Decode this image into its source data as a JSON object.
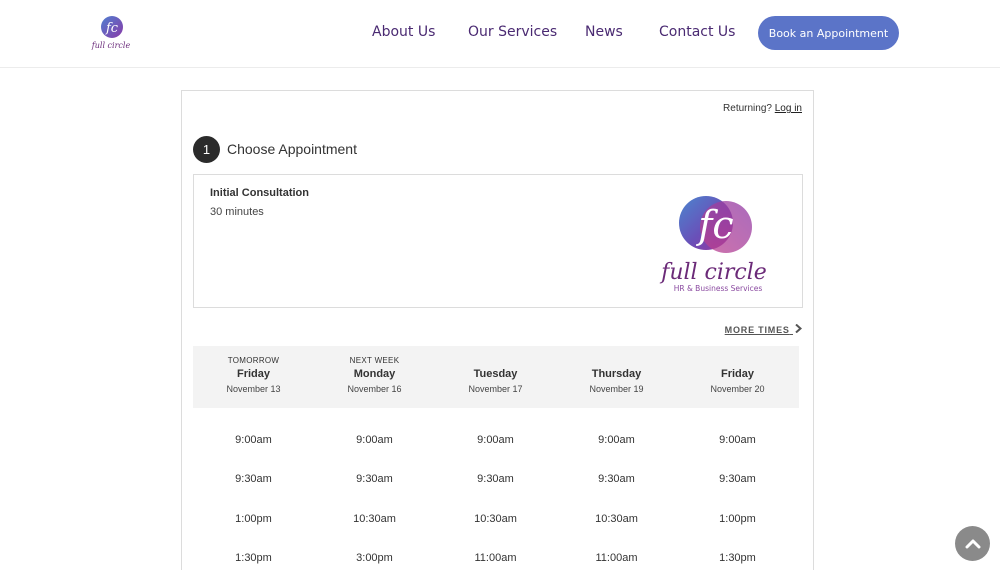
{
  "header": {
    "nav": [
      {
        "label": "About Us"
      },
      {
        "label": "Our Services"
      },
      {
        "label": "News"
      },
      {
        "label": "Contact Us"
      }
    ],
    "book_label": "Book an Appointment",
    "logo_small_text": "full circle"
  },
  "card": {
    "returning_text": "Returning?",
    "login_label": "Log in",
    "step_number": "1",
    "step_title": "Choose Appointment",
    "appointment": {
      "name": "Initial Consultation",
      "duration": "30 minutes"
    },
    "logo_big": {
      "monogram": "fc",
      "script": "full circle",
      "tagline": "HR & Business Services"
    },
    "more_times_label": "MORE TIMES",
    "days": [
      {
        "pre": "TOMORROW",
        "name": "Friday",
        "date": "November 13"
      },
      {
        "pre": "NEXT WEEK",
        "name": "Monday",
        "date": "November 16"
      },
      {
        "pre": "",
        "name": "Tuesday",
        "date": "November 17"
      },
      {
        "pre": "",
        "name": "Thursday",
        "date": "November 19"
      },
      {
        "pre": "",
        "name": "Friday",
        "date": "November 20"
      }
    ],
    "slots": [
      [
        "9:00am",
        "9:30am",
        "1:00pm",
        "1:30pm"
      ],
      [
        "9:00am",
        "9:30am",
        "10:30am",
        "3:00pm"
      ],
      [
        "9:00am",
        "9:30am",
        "10:30am",
        "11:00am"
      ],
      [
        "9:00am",
        "9:30am",
        "10:30am",
        "11:00am"
      ],
      [
        "9:00am",
        "9:30am",
        "1:00pm",
        "1:30pm"
      ]
    ]
  },
  "colors": {
    "nav_text": "#4a2a72",
    "book_button": "#5b74c8",
    "scroll_button": "#8a8a8a"
  }
}
